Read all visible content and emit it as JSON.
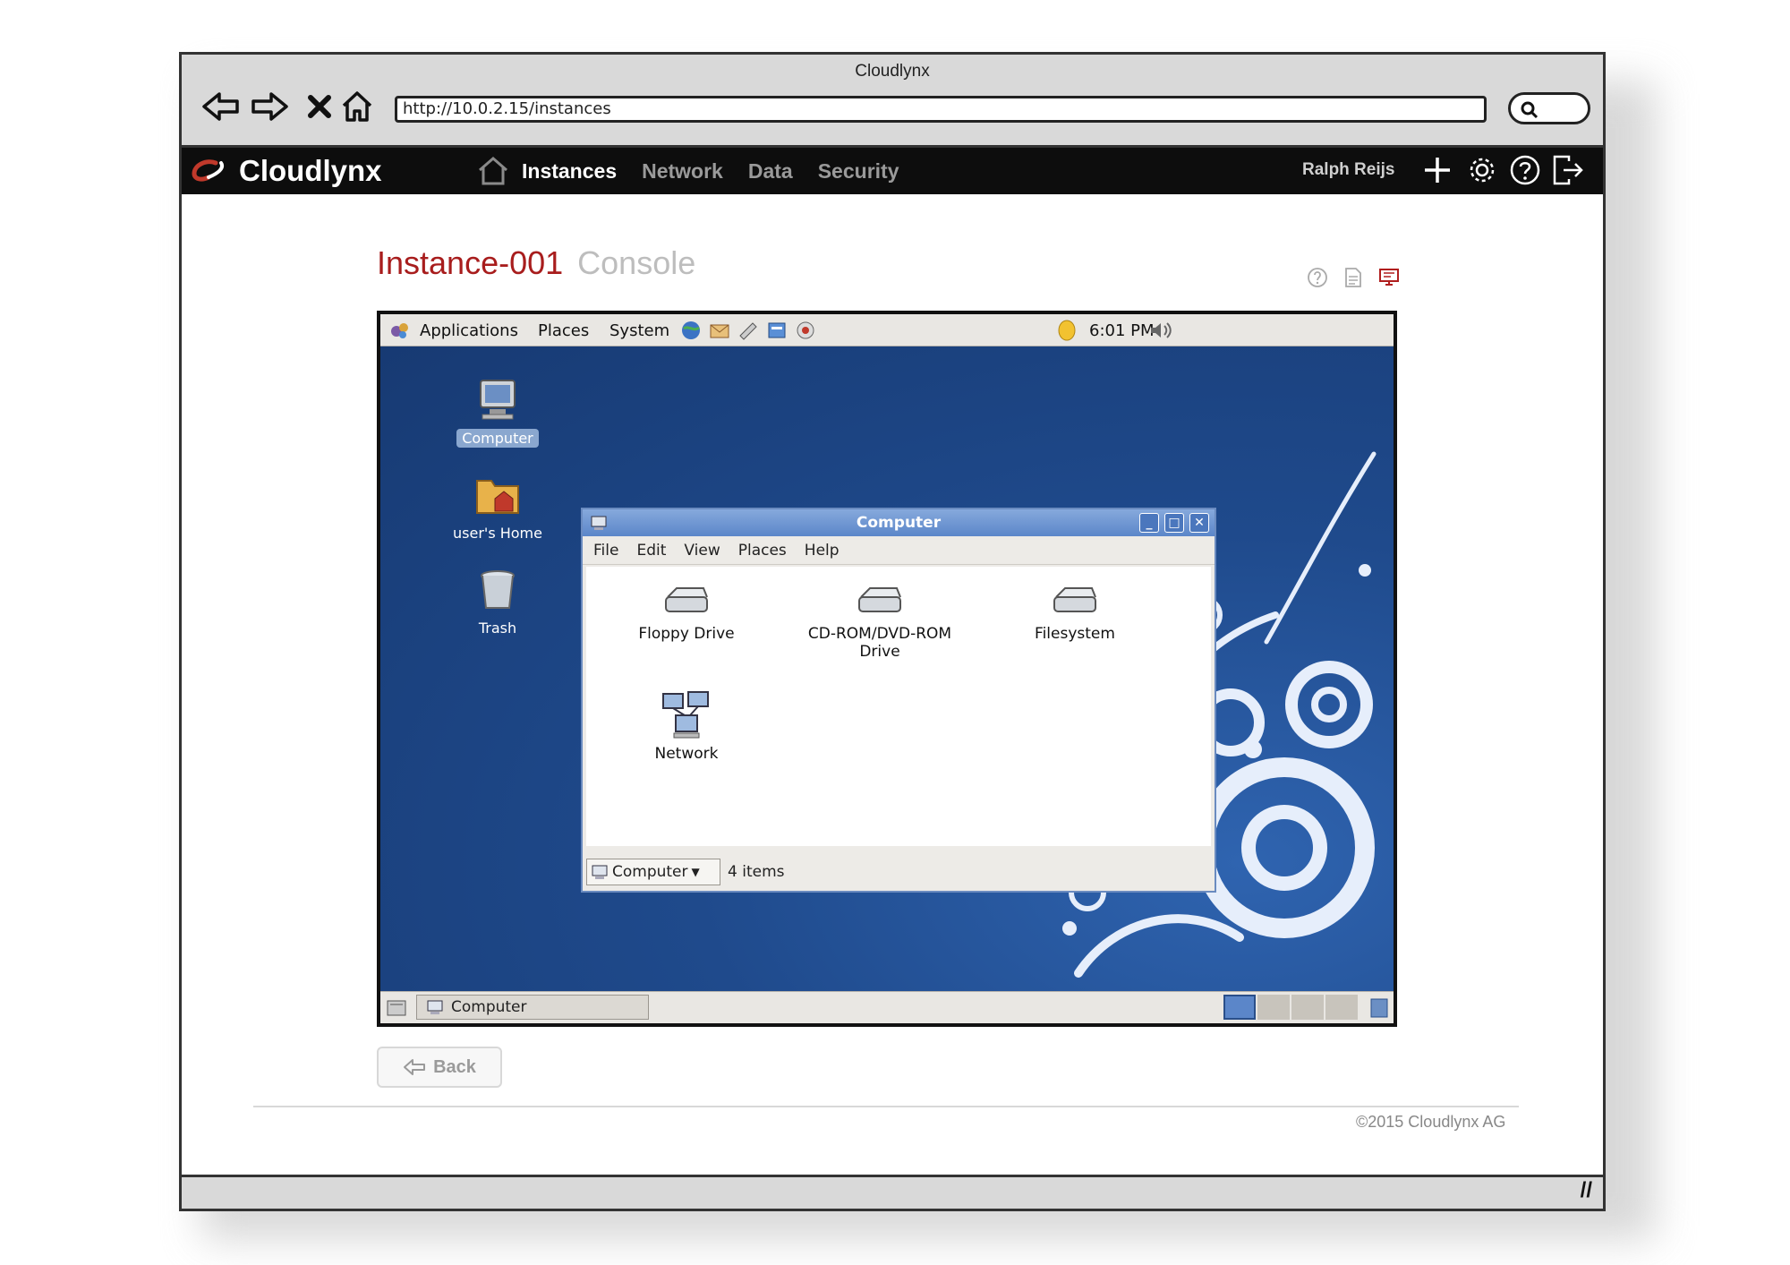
{
  "window": {
    "title": "Cloudlynx"
  },
  "browser": {
    "url": "http://10.0.2.15/instances"
  },
  "app": {
    "brand": "Cloudlynx",
    "nav": [
      {
        "label": "Instances",
        "active": true
      },
      {
        "label": "Network",
        "active": false
      },
      {
        "label": "Data",
        "active": false
      },
      {
        "label": "Security",
        "active": false
      }
    ],
    "user": "Ralph Reijs"
  },
  "page": {
    "instance": "Instance-001",
    "section": "Console",
    "back_label": "Back",
    "copyright": "©2015 Cloudlynx AG"
  },
  "console": {
    "panel": {
      "menus": [
        "Applications",
        "Places",
        "System"
      ],
      "clock": "6:01 PM"
    },
    "desktop_icons": [
      "Computer",
      "user's Home",
      "Trash"
    ],
    "file_manager": {
      "title": "Computer",
      "menu": [
        "File",
        "Edit",
        "View",
        "Places",
        "Help"
      ],
      "items": [
        {
          "line1": "Floppy Drive",
          "line2": ""
        },
        {
          "line1": "CD-ROM/DVD-ROM",
          "line2": "Drive"
        },
        {
          "line1": "Filesystem",
          "line2": ""
        },
        {
          "line1": "Network",
          "line2": ""
        }
      ],
      "location": "Computer",
      "count": "4 items"
    },
    "taskbar": {
      "task": "Computer"
    }
  }
}
